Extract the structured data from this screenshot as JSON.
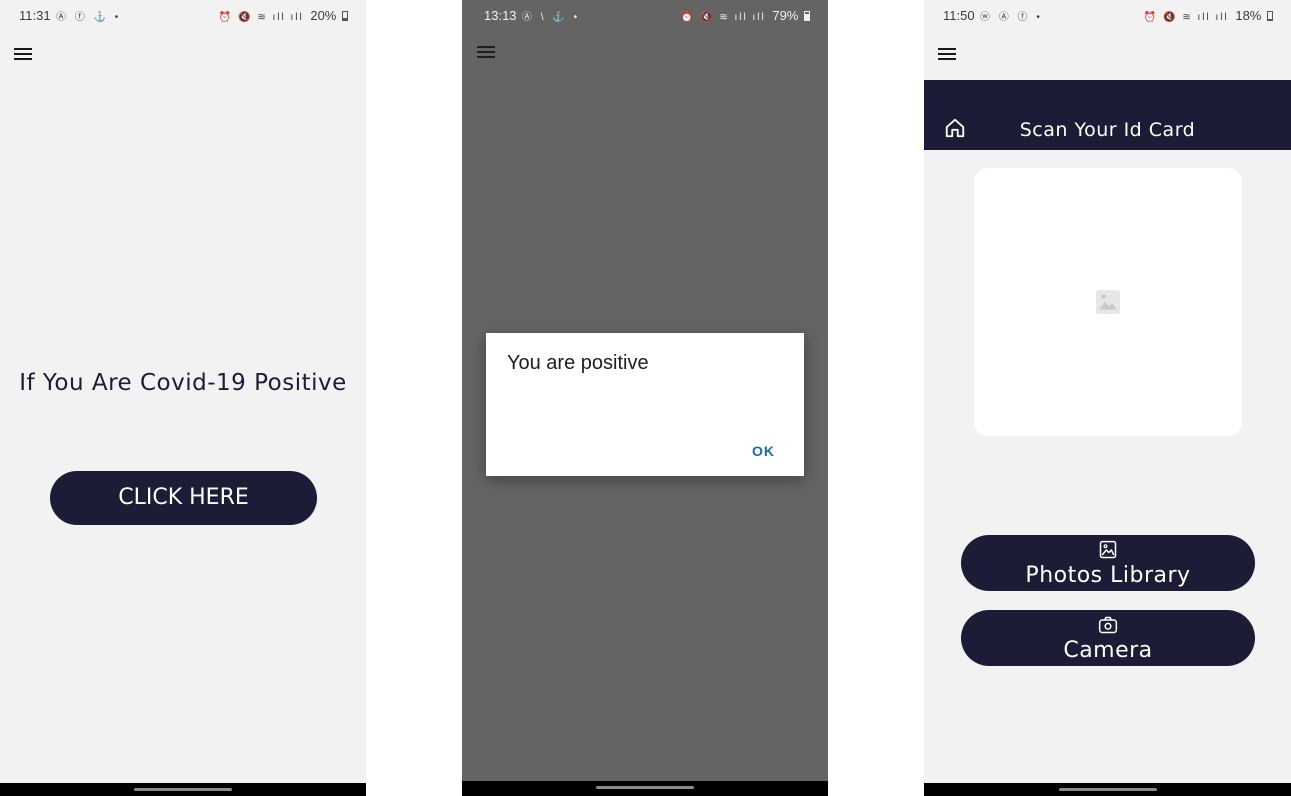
{
  "screens": [
    {
      "status": {
        "time": "11:31",
        "battery": "20%",
        "battery_level": 0.2,
        "left_icons": "Ⓐ ⓕ ⚓ •",
        "right_icons": "⏰ 🔇 ≋ ıll ıll"
      },
      "headline": "If You Are Covid-19 Positive",
      "button_label": "CLICK HERE"
    },
    {
      "status": {
        "time": "13:13",
        "battery": "79%",
        "battery_level": 0.79,
        "left_icons": "Ⓐ \\ ⚓ •",
        "right_icons": "⏰ 🔇 ≋ ıll ıll"
      },
      "dialog": {
        "title": "You are positive",
        "ok_label": "OK"
      }
    },
    {
      "status": {
        "time": "11:50",
        "battery": "18%",
        "battery_level": 0.18,
        "left_icons": "ⓦ Ⓐ ⓕ •",
        "right_icons": "⏰ 🔇 ≋ ıll ıll"
      },
      "header_title": "Scan Your Id Card",
      "photos_button_label": "Photos Library",
      "camera_button_label": "Camera"
    }
  ],
  "colors": {
    "primary": "#1d1c37",
    "background": "#f2f2f2",
    "overlay": "#646464",
    "dialog_accent": "#1c6ba4"
  },
  "icons": [
    "menu-icon",
    "home-icon",
    "image-placeholder-icon",
    "image-icon",
    "camera-icon"
  ]
}
